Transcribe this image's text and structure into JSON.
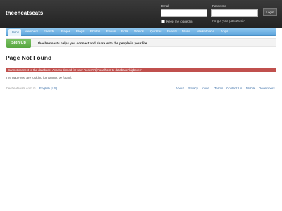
{
  "header": {
    "site_name": "thecheatseats",
    "email_label": "Email",
    "password_label": "Password",
    "login_button": "Login",
    "remember_label": "Keep me logged in",
    "forgot_link": "Forgot your password?"
  },
  "nav": {
    "items": [
      "Home",
      "Members",
      "Friends",
      "Pages",
      "Blogs",
      "Photos",
      "Forum",
      "Polls",
      "Videos",
      "Quizzes",
      "Events",
      "Music",
      "Marketplace",
      "Apps"
    ]
  },
  "signup": {
    "button": "Sign Up",
    "text": "thecheatseats helps you connect and share with the people in your life."
  },
  "main": {
    "title": "Page Not Found",
    "error": "Cannot connect to the database. Access denied for user 'bonre's'@'localhost' to database 'bigbores'",
    "message": "The page you are looking for cannot be found."
  },
  "footer": {
    "copyright": "thecheatseats.com ©",
    "language": "English (US)",
    "links": [
      "About",
      "Privacy",
      "Invite",
      "Terms",
      "Contact Us",
      "Mobile",
      "Developers"
    ]
  }
}
